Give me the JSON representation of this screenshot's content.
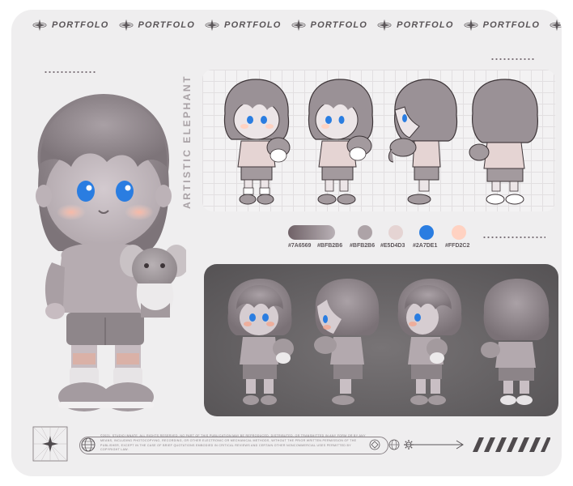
{
  "header": {
    "repeat_label": "PORTFOLO",
    "repeat_count": 7
  },
  "sheet": {
    "vertical_title": "ARTISTIC  ELEPHANT"
  },
  "palette": [
    {
      "hex_label": "#7A6569",
      "gradient": [
        "#6f6166",
        "#b9b1b6"
      ]
    },
    {
      "hex_label": "#BFB2B6",
      "color": "#ada3a7"
    },
    {
      "hex_label": "#BFB2B6",
      "color": "#a39a9e"
    },
    {
      "hex_label": "#E5D4D3",
      "color": "#e5d4d3"
    },
    {
      "hex_label": "#2A7DE1",
      "color": "#2a7de1"
    },
    {
      "hex_label": "#FFD2C2",
      "color": "#ffd2c2"
    }
  ],
  "footer": {
    "legal_text": "©2021. STUDIO INNATE. ALL RIGHTS RESERVED. NO PART OF THIS PUBLICATION MAY BE REPRODUCED, DISTRIBUTED, OR TRANSMITTED IN ANY FORM OR BY ANY MEANS, INCLUDING PHOTOCOPYING, RECORDING, OR OTHER ELECTRONIC OR MECHANICAL METHODS, WITHOUT THE PRIOR WRITTEN PERMISSION OF THE PUBLISHER, EXCEPT IN THE CASE OF BRIEF QUOTATIONS EMBODIED IN CRITICAL REVIEWS AND CERTAIN OTHER NONCOMMERCIAL USES PERMITTED BY COPYRIGHT LAW."
  },
  "colors": {
    "frame_bg": "#efeeef",
    "figure_gray": "#9a9196",
    "eye_blue": "#2a7de1",
    "blush": "#ffd2c2"
  }
}
